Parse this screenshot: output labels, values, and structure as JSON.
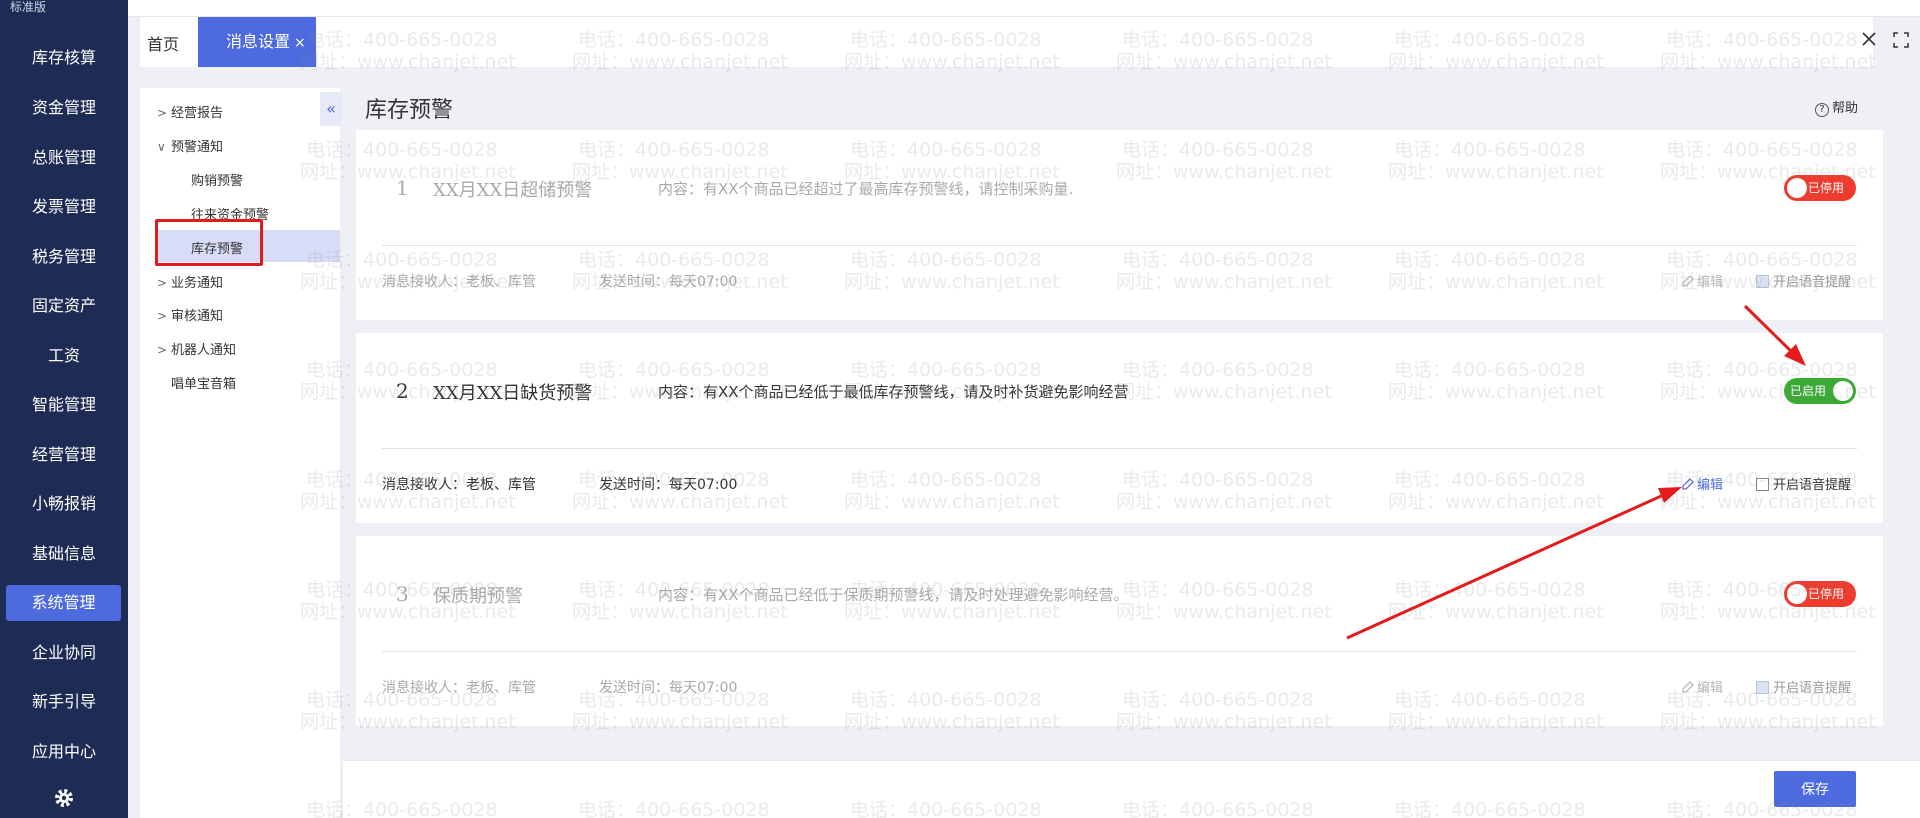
{
  "nav": {
    "edition": "标准版",
    "items": [
      "库存核算",
      "资金管理",
      "总账管理",
      "发票管理",
      "税务管理",
      "固定资产",
      "工资",
      "智能管理",
      "经营管理",
      "小畅报销",
      "基础信息",
      "系统管理",
      "企业协同",
      "新手引导",
      "应用中心"
    ],
    "active": "系统管理"
  },
  "tabs": {
    "home": "首页",
    "active": "消息设置",
    "close_glyph": "×"
  },
  "sidebar": {
    "collapse_glyph": "«",
    "items": [
      {
        "label": "经营报告",
        "arrow": ">"
      },
      {
        "label": "预警通知",
        "arrow": "∨"
      },
      {
        "label": "购销预警"
      },
      {
        "label": "往来资金预警"
      },
      {
        "label": "库存预警"
      },
      {
        "label": "业务通知",
        "arrow": ">"
      },
      {
        "label": "审核通知",
        "arrow": ">"
      },
      {
        "label": "机器人通知",
        "arrow": ">"
      },
      {
        "label": "唱单宝音箱"
      }
    ]
  },
  "page": {
    "title": "库存预警",
    "help": "帮助",
    "help_glyph": "?"
  },
  "cards": [
    {
      "num": "1",
      "name": "XX月XX日超储预警",
      "content": "内容：有XX个商品已经超过了最高库存预警线，请控制采购量.",
      "recv": "消息接收人：老板、库管",
      "time": "发送时间：每天07:00",
      "edit": "编辑",
      "voice": "开启语音提醒",
      "status": "已停用"
    },
    {
      "num": "2",
      "name": "XX月XX日缺货预警",
      "content": "内容：有XX个商品已经低于最低库存预警线，请及时补货避免影响经营",
      "recv": "消息接收人：老板、库管",
      "time": "发送时间：每天07:00",
      "edit": "编辑",
      "voice": "开启语音提醒",
      "status": "已启用"
    },
    {
      "num": "3",
      "name": "保质期预警",
      "content": "内容：有XX个商品已经低于保质期预警线，请及时处理避免影响经营。",
      "recv": "消息接收人：老板、库管",
      "time": "发送时间：每天07:00",
      "edit": "编辑",
      "voice": "开启语音提醒",
      "status": "已停用"
    }
  ],
  "footer": {
    "save": "保存"
  },
  "watermark": {
    "phone": "电话：400-665-0028",
    "site": "网址：www.chanjet.net"
  },
  "colors": {
    "nav_bg": "#1d2b55",
    "accent": "#4d6bde",
    "toggle_off": "#ef3b2d",
    "toggle_on": "#3aaa35",
    "annotation": "#e41b1b"
  }
}
